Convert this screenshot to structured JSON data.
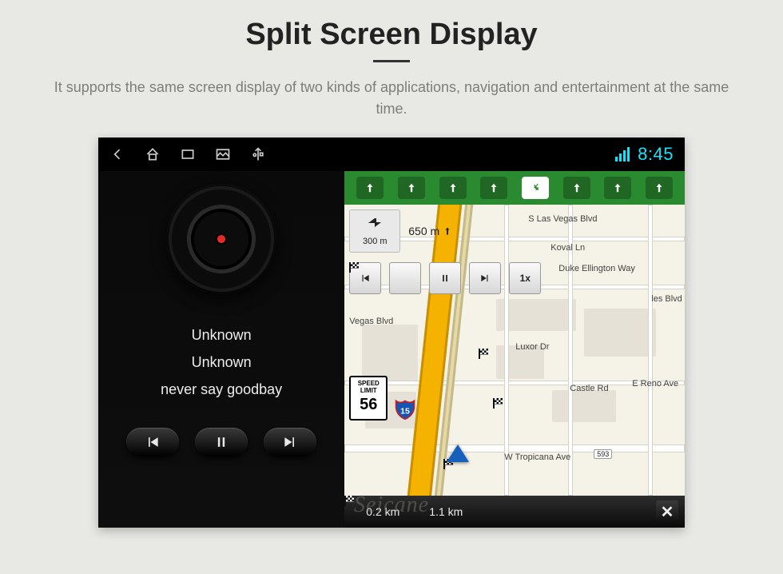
{
  "hero": {
    "title": "Split Screen Display",
    "subtitle": "It supports the same screen display of two kinds of applications, navigation and entertainment at the same time."
  },
  "statusbar": {
    "clock": "8:45"
  },
  "media": {
    "artist": "Unknown",
    "album": "Unknown",
    "track": "never say goodbay"
  },
  "nav": {
    "turn_distance": "300 m",
    "approach_distance": "650 m",
    "speed_buttons": {
      "rew": "",
      "flag": "",
      "pause": "",
      "next": "",
      "speed": "1x"
    },
    "speed_limit_label_1": "SPEED",
    "speed_limit_label_2": "LIMIT",
    "speed_limit_value": "56",
    "interstate": "15",
    "addr_tag": "593",
    "streets": {
      "s_las_vegas": "S Las Vegas Blvd",
      "koval": "Koval Ln",
      "duke": "Duke Ellington Way",
      "vegas_blvd_left": "Vegas Blvd",
      "luxor": "Luxor Dr",
      "castle": "Castle Rd",
      "e_reno": "E Reno Ave",
      "tropicana": "W Tropicana Ave",
      "les_blvd": "les Blvd"
    },
    "bottom": {
      "dist1": "0.2 km",
      "dist2": "1.1 km"
    }
  },
  "watermark": "Seicane"
}
